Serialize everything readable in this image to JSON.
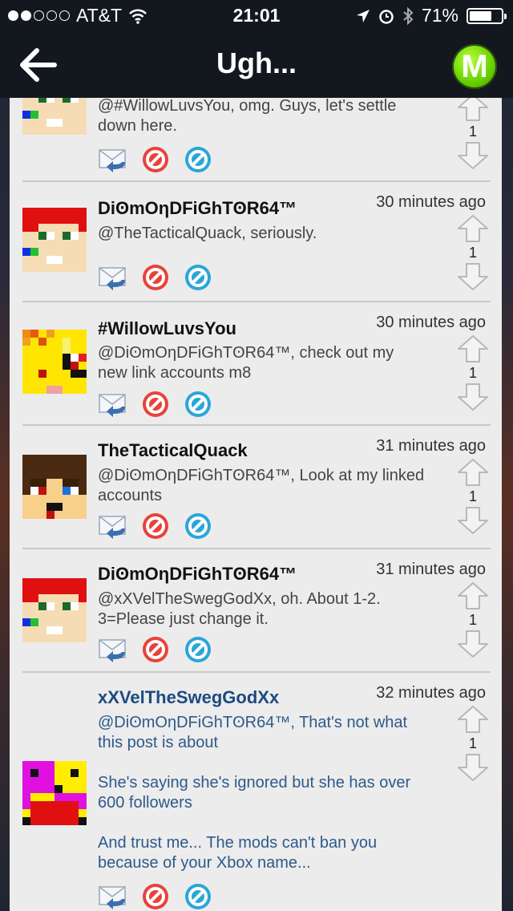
{
  "status": {
    "carrier": "AT&T",
    "time": "21:01",
    "battery": "71%",
    "battery_level": 0.71
  },
  "nav": {
    "title": "Ugh...",
    "badge": "M"
  },
  "comments": [
    {
      "author": "",
      "time": "",
      "lines": [
        "@#WillowLuvsYou, omg. Guys, let's settle down here."
      ],
      "votes": "1"
    },
    {
      "author": "DiʘmOƞDFiGhTʘR64™",
      "time": "30 minutes ago",
      "lines": [
        "@TheTacticalQuack, seriously."
      ],
      "votes": "1"
    },
    {
      "author": "#WillowLuvsYou",
      "time": "30 minutes ago",
      "lines": [
        "@DiʘmOƞDFiGhTʘR64™, check out my new link accounts m8"
      ],
      "votes": "1"
    },
    {
      "author": "TheTacticalQuack",
      "time": "31 minutes ago",
      "lines": [
        "@DiʘmOƞDFiGhTʘR64™, Look at my linked accounts"
      ],
      "votes": "1"
    },
    {
      "author": "DiʘmOƞDFiGhTʘR64™",
      "time": "31 minutes ago",
      "lines": [
        "@xXVelTheSwegGodXx, oh. About 1-2. 3=Please just change it."
      ],
      "votes": "1"
    },
    {
      "author": "xXVelTheSwegGodXx",
      "time": "32 minutes ago",
      "lines": [
        "@DiʘmOƞDFiGhTʘR64™, That's not what this post is about",
        "She's saying she's ignored but she has over 600 followers",
        "And trust me... The mods can't ban you because of your Xbox name..."
      ],
      "votes": "1"
    }
  ],
  "icons": {
    "reply": "reply-mail-icon",
    "report": "report-icon",
    "block": "block-icon",
    "upvote": "upvote-arrow-icon",
    "downvote": "downvote-arrow-icon"
  },
  "colors": {
    "report": "#e8423a",
    "block": "#2aa6d8",
    "badge": "#6ad100"
  }
}
